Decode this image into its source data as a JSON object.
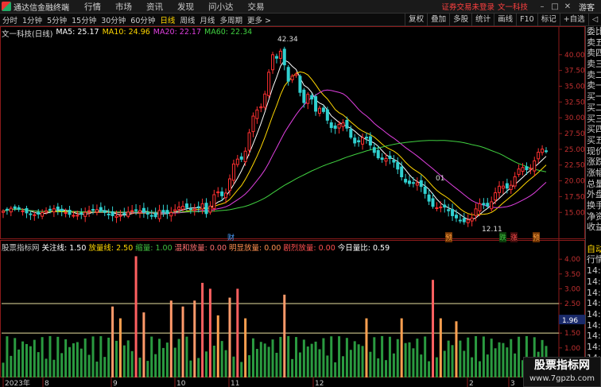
{
  "app": {
    "name": "通达信金融终端"
  },
  "menu": [
    "行情",
    "市场",
    "资讯",
    "发现",
    "问小达",
    "交易"
  ],
  "login_status": "证券交易未登录",
  "login_stock": "文一科技",
  "window_controls": [
    "–",
    "□",
    "✕"
  ],
  "guest_label": "游客",
  "periods": [
    {
      "label": "分时",
      "active": false
    },
    {
      "label": "1分钟",
      "active": false
    },
    {
      "label": "5分钟",
      "active": false
    },
    {
      "label": "15分钟",
      "active": false
    },
    {
      "label": "30分钟",
      "active": false
    },
    {
      "label": "60分钟",
      "active": false
    },
    {
      "label": "日线",
      "active": true
    },
    {
      "label": "周线",
      "active": false
    },
    {
      "label": "月线",
      "active": false
    },
    {
      "label": "多周期",
      "active": false
    },
    {
      "label": "更多 >",
      "active": false
    }
  ],
  "right_tools": [
    "复权",
    "叠加",
    "多股",
    "统计",
    "画线",
    "F10",
    "标记",
    "+自选",
    "◁"
  ],
  "chart": {
    "stock_title": "文一科技(日线)",
    "ma": [
      {
        "label": "MA5: 25.17",
        "color": "#ffffff"
      },
      {
        "label": "MA10: 24.96",
        "color": "#ffd700"
      },
      {
        "label": "MA20: 22.17",
        "color": "#e040e0"
      },
      {
        "label": "MA60: 22.34",
        "color": "#40d040"
      }
    ],
    "price_axis": [
      "40.00",
      "37.50",
      "35.00",
      "32.50",
      "30.00",
      "27.50",
      "25.00",
      "22.50",
      "20.00",
      "17.50",
      "15.00"
    ],
    "high_label": "42.34",
    "low_label": "12.11",
    "event_tags": [
      {
        "text": "财",
        "color": "#4aa0ff"
      },
      {
        "text": "预",
        "color": "#ffa040"
      },
      {
        "text": "跌",
        "color": "#40c040"
      },
      {
        "text": "涨",
        "color": "#ff5050"
      },
      {
        "text": "预",
        "color": "#ffa040"
      }
    ],
    "min_marker": "01"
  },
  "volume": {
    "legend": [
      {
        "text": "股票指标网",
        "color": "#cccccc"
      },
      {
        "text": "关注线: 1.50",
        "color": "#ffffff"
      },
      {
        "text": "放量线: 2.50",
        "color": "#ffd700"
      },
      {
        "text": "缩量: 1.00",
        "color": "#40c040"
      },
      {
        "text": "温和放量: 0.00",
        "color": "#ff7070"
      },
      {
        "text": "明显放量: 0.00",
        "color": "#ff9050"
      },
      {
        "text": "剧烈放量: 0.00",
        "color": "#ff5050"
      },
      {
        "text": "今日量比: 0.59",
        "color": "#ffffff"
      }
    ],
    "axis": [
      "4.00",
      "3.50",
      "3.00",
      "2.50",
      "2.00",
      "1.50",
      "1.00"
    ],
    "current_label": "1.96",
    "date_labels": [
      "2023年",
      "8",
      "9",
      "10",
      "11",
      "12",
      "2",
      "3"
    ]
  },
  "quote_panel": [
    "委比",
    "卖五",
    "卖四",
    "卖三",
    "卖二",
    "卖一",
    "买一",
    "买二",
    "买三",
    "买四",
    "买五",
    "现价",
    "涨跌",
    "涨幅",
    "总量",
    "外盘",
    "换手",
    "净资",
    "收益",
    "",
    "自动",
    "行情",
    "14:5",
    "14:5",
    "14:5",
    "14:5",
    "14:5",
    "14:5",
    "14:5",
    "14:5",
    "14:5",
    "14:5"
  ],
  "watermark": {
    "title": "股票指标网",
    "url": "www.7gpzb.com"
  }
}
